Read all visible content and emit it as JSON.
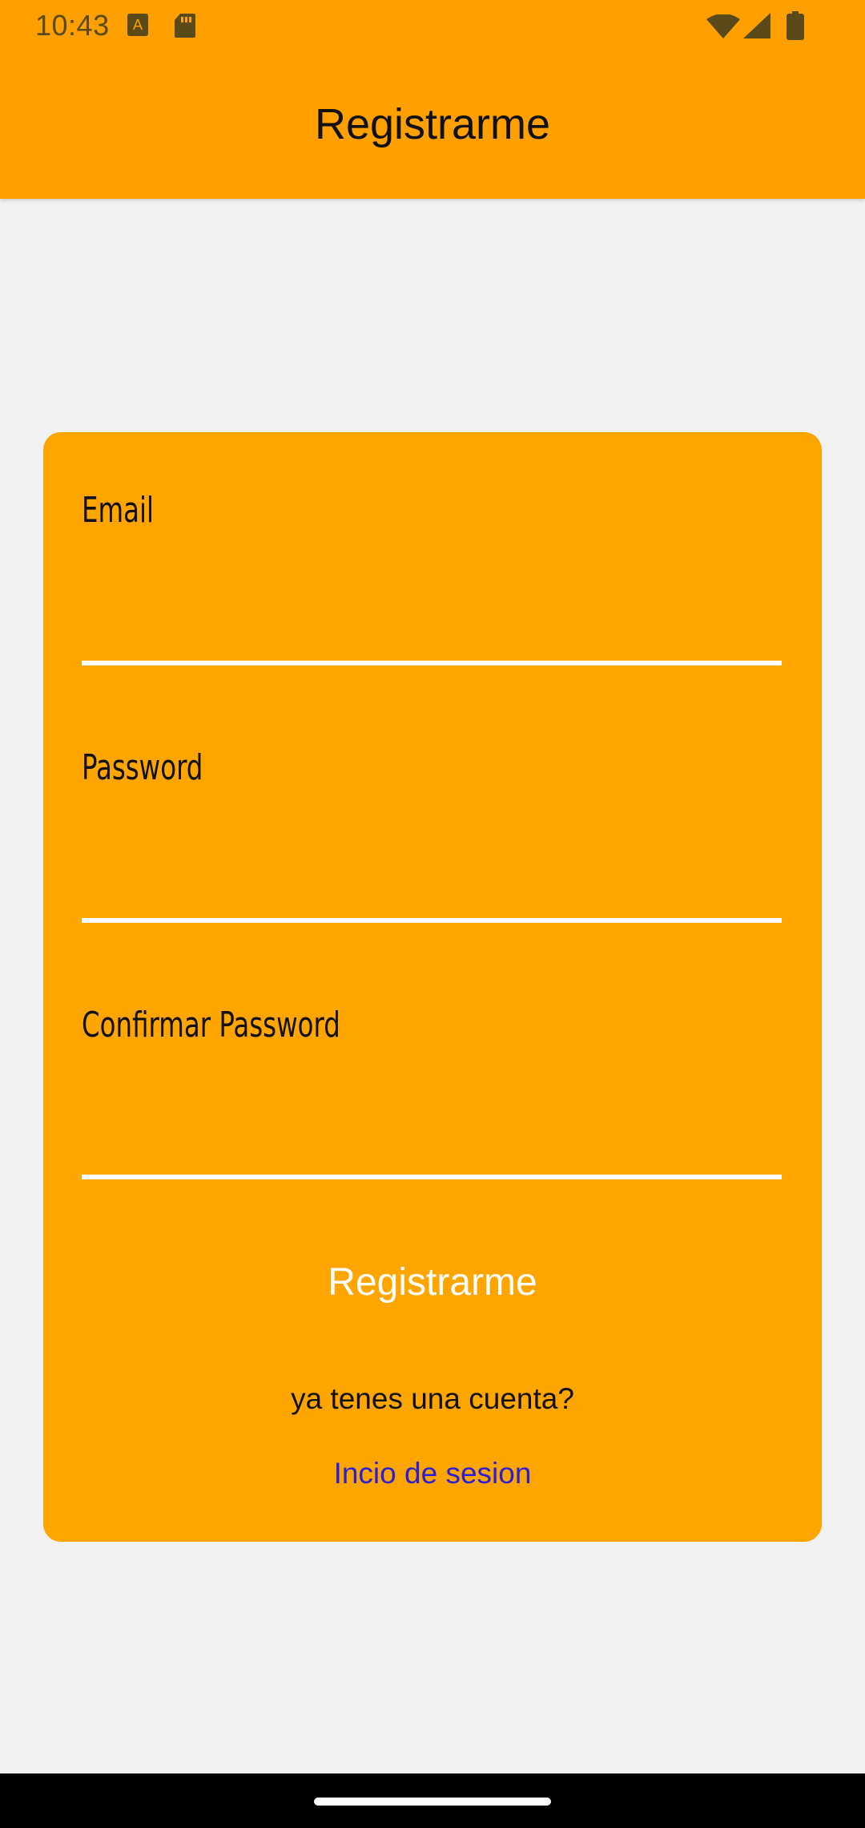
{
  "status_bar": {
    "time": "10:43",
    "icons_left": [
      "a-badge-icon",
      "sd-card-icon"
    ],
    "icons_right": [
      "wifi-icon",
      "signal-icon",
      "battery-icon"
    ]
  },
  "app_bar": {
    "title": "Registrarme"
  },
  "form": {
    "email_label": "Email",
    "email_value": "",
    "password_label": "Password",
    "password_value": "",
    "confirm_label": "Confirmar Password",
    "confirm_value": "",
    "register_button": "Registrarme",
    "question": "ya tenes una cuenta?",
    "login_link": "Incio de sesion"
  },
  "colors": {
    "accent": "#ffa000",
    "card": "#ffa500",
    "link": "#2a1fd6",
    "background": "#f2f2f2"
  }
}
